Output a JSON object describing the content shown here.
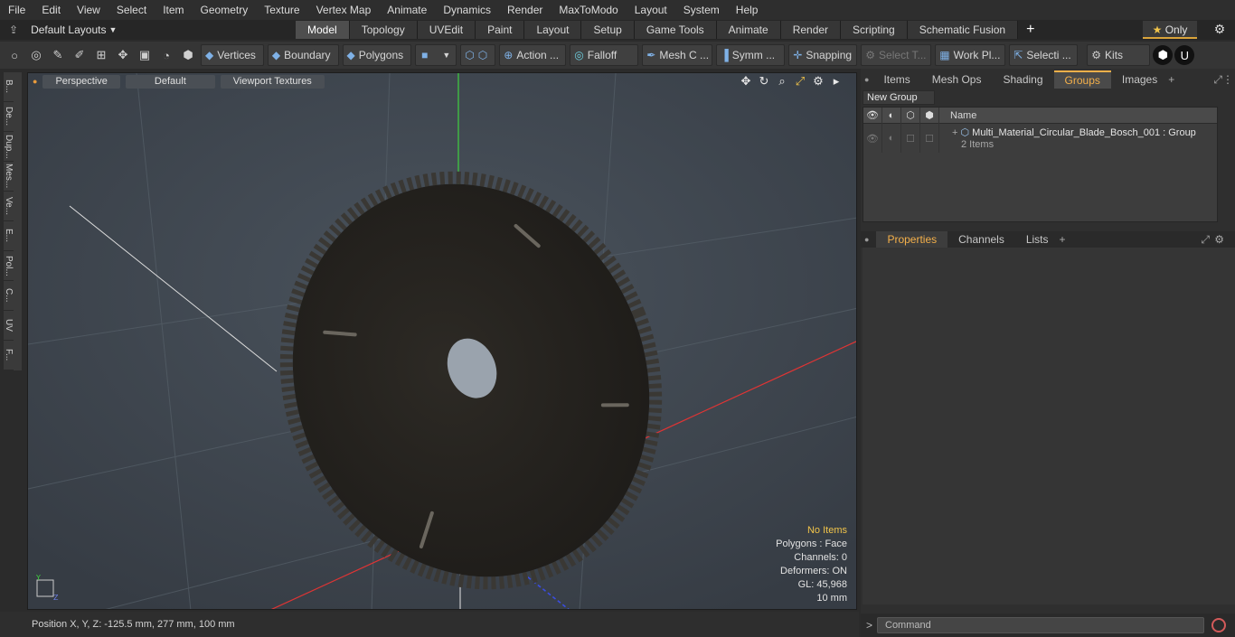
{
  "menu": [
    "File",
    "Edit",
    "View",
    "Select",
    "Item",
    "Geometry",
    "Texture",
    "Vertex Map",
    "Animate",
    "Dynamics",
    "Render",
    "MaxToModo",
    "Layout",
    "System",
    "Help"
  ],
  "layouts": {
    "label": "Default Layouts"
  },
  "tabs": [
    "Model",
    "Topology",
    "UVEdit",
    "Paint",
    "Layout",
    "Setup",
    "Game Tools",
    "Animate",
    "Render",
    "Scripting",
    "Schematic Fusion"
  ],
  "active_tab": "Model",
  "only_label": "Only",
  "toolbar": {
    "vertices": "Vertices",
    "boundary": "Boundary",
    "polygons": "Polygons",
    "action": "Action ...",
    "falloff": "Falloff",
    "meshc": "Mesh C ...",
    "symm": "Symm ...",
    "snapping": "Snapping",
    "selectt": "Select T...",
    "workpl": "Work Pl...",
    "selecti": "Selecti ...",
    "kits": "Kits"
  },
  "sidebar": [
    "B...",
    "De...",
    "Dup...",
    "Mes...",
    "Ve...",
    "E...",
    "Pol...",
    "C...",
    "UV",
    "F..."
  ],
  "viewport": {
    "perspective": "Perspective",
    "default": "Default",
    "textures": "Viewport Textures",
    "stats": {
      "no_items": "No Items",
      "polygons": "Polygons : Face",
      "channels": "Channels: 0",
      "deformers": "Deformers: ON",
      "gl": "GL: 45,968",
      "scale": "10 mm"
    }
  },
  "status": {
    "position": "Position X, Y, Z:  -125.5 mm, 277 mm, 100 mm"
  },
  "right_tabs": [
    "Items",
    "Mesh Ops",
    "Shading",
    "Groups",
    "Images"
  ],
  "right_active": "Groups",
  "new_group": "New Group",
  "group_list": {
    "name_col": "Name",
    "item": "Multi_Material_Circular_Blade_Bosch_001 : Group",
    "sub": "2 Items"
  },
  "prop_tabs": [
    "Properties",
    "Channels",
    "Lists"
  ],
  "prop_active": "Properties",
  "command_placeholder": "Command"
}
